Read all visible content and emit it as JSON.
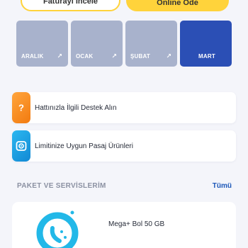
{
  "top_buttons": {
    "secondary_label": "Faturayı İncele",
    "primary_label": "Online Öde"
  },
  "months": [
    {
      "label": "ARALIK",
      "active": false
    },
    {
      "label": "OCAK",
      "active": false
    },
    {
      "label": "ŞUBAT",
      "active": false
    },
    {
      "label": "MART",
      "active": true
    }
  ],
  "cards": [
    {
      "label": "Hattınızla İlgili Destek Alın",
      "icon": "question-icon",
      "color": "#f58a1f"
    },
    {
      "label": "Limitinize Uygun Pasaj Ürünleri",
      "icon": "shopping-icon",
      "color": "#1e9ae0"
    }
  ],
  "section": {
    "title": "PAKET VE SERVİSLERİM",
    "link": "Tümü"
  },
  "package": {
    "name": "Mega+ Bol 50 GB",
    "icon": "phone-call-icon"
  },
  "colors": {
    "accent_yellow": "#ffd33b",
    "month_inactive": "#a8b2cc",
    "month_active": "#2b4fb5",
    "link_blue": "#1c57b8"
  }
}
